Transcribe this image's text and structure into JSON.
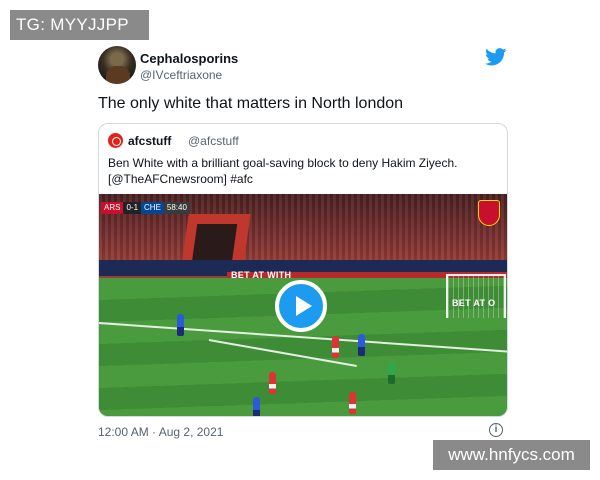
{
  "watermarks": {
    "top_left": "TG: MYYJJPP",
    "bottom_right": "www.hnfycs.com"
  },
  "tweet": {
    "display_name": "Cephalosporins",
    "handle": "@IVceftriaxone",
    "text": "The only white that matters in North london",
    "timestamp": "12:00 AM · Aug 2, 2021",
    "brand_icon": "twitter-bird-icon",
    "brand_color": "#1d9bf0",
    "info_glyph": "i"
  },
  "quote_tweet": {
    "display_name": "afcstuff",
    "handle": "@afcstuff",
    "text_line1": "Ben White with a brilliant goal-saving block to deny Hakim Ziyech.",
    "text_line2": "[@TheAFCnewsroom] #afc",
    "video": {
      "scoreboard": {
        "home": "ARS",
        "score": "0-1",
        "away": "CHE",
        "clock": "58:40"
      },
      "board_text_1": "BET AT WITH",
      "board_text_2": "BET AT O",
      "play_icon": "play-icon"
    }
  }
}
